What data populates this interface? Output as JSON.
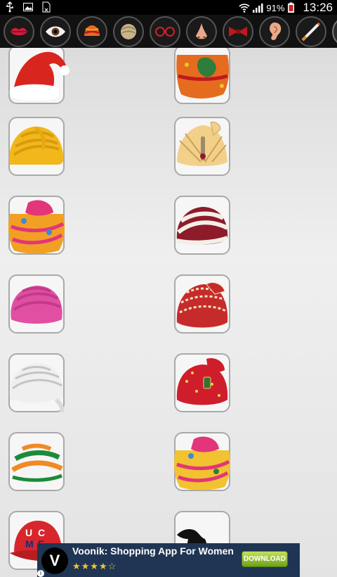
{
  "status_bar": {
    "icons": [
      "usb-icon",
      "image-icon",
      "sim-icon",
      "wifi-icon",
      "signal-icon",
      "battery-icon"
    ],
    "battery": "91%",
    "time": "13:26"
  },
  "categories": [
    {
      "name": "lips",
      "icon": "lips-icon"
    },
    {
      "name": "eyes",
      "icon": "eye-icon"
    },
    {
      "name": "turbans",
      "icon": "turban-icon"
    },
    {
      "name": "hair",
      "icon": "hair-icon"
    },
    {
      "name": "glasses",
      "icon": "glasses-icon"
    },
    {
      "name": "nose",
      "icon": "nose-icon"
    },
    {
      "name": "bow tie",
      "icon": "bowtie-icon"
    },
    {
      "name": "ear",
      "icon": "ear-icon"
    },
    {
      "name": "cigarette",
      "icon": "cigarette-icon"
    }
  ],
  "stickers": [
    {
      "name": "santa-hat",
      "colors": [
        "#d8261e",
        "#ffffff"
      ]
    },
    {
      "name": "orange-patterned-turban",
      "colors": [
        "#e56b1f",
        "#2f7d3a"
      ]
    },
    {
      "name": "yellow-turban",
      "colors": [
        "#f1b81c",
        "#d99a0e"
      ]
    },
    {
      "name": "cream-turban-with-brooch",
      "colors": [
        "#f2d08a",
        "#c7a35a"
      ]
    },
    {
      "name": "pink-patterned-turban",
      "colors": [
        "#e2357a",
        "#f2a024"
      ]
    },
    {
      "name": "maroon-white-turban",
      "colors": [
        "#8e1b2a",
        "#f4efe6"
      ]
    },
    {
      "name": "pink-turban",
      "colors": [
        "#e14fa3",
        "#c23b8a"
      ]
    },
    {
      "name": "embroidered-red-turban",
      "colors": [
        "#c62b2b",
        "#f1e2c0"
      ]
    },
    {
      "name": "white-turban",
      "colors": [
        "#efefef",
        "#cfcfcf"
      ]
    },
    {
      "name": "red-jeweled-turban",
      "colors": [
        "#d01d2c",
        "#f3d04b"
      ]
    },
    {
      "name": "tricolor-turban",
      "colors": [
        "#f08a24",
        "#1c8a3c"
      ]
    },
    {
      "name": "pink-yellow-turban",
      "colors": [
        "#e2357a",
        "#f2c230"
      ]
    },
    {
      "name": "red-cap",
      "colors": [
        "#d7262c",
        "#1a2a7a"
      ]
    },
    {
      "name": "black-hat",
      "colors": [
        "#111111",
        "#333333"
      ]
    }
  ],
  "ad": {
    "title": "Voonik: Shopping App For Women",
    "logo_letter": "V",
    "stars": "★★★★☆",
    "button": "DOWNLOAD",
    "info": "i"
  }
}
